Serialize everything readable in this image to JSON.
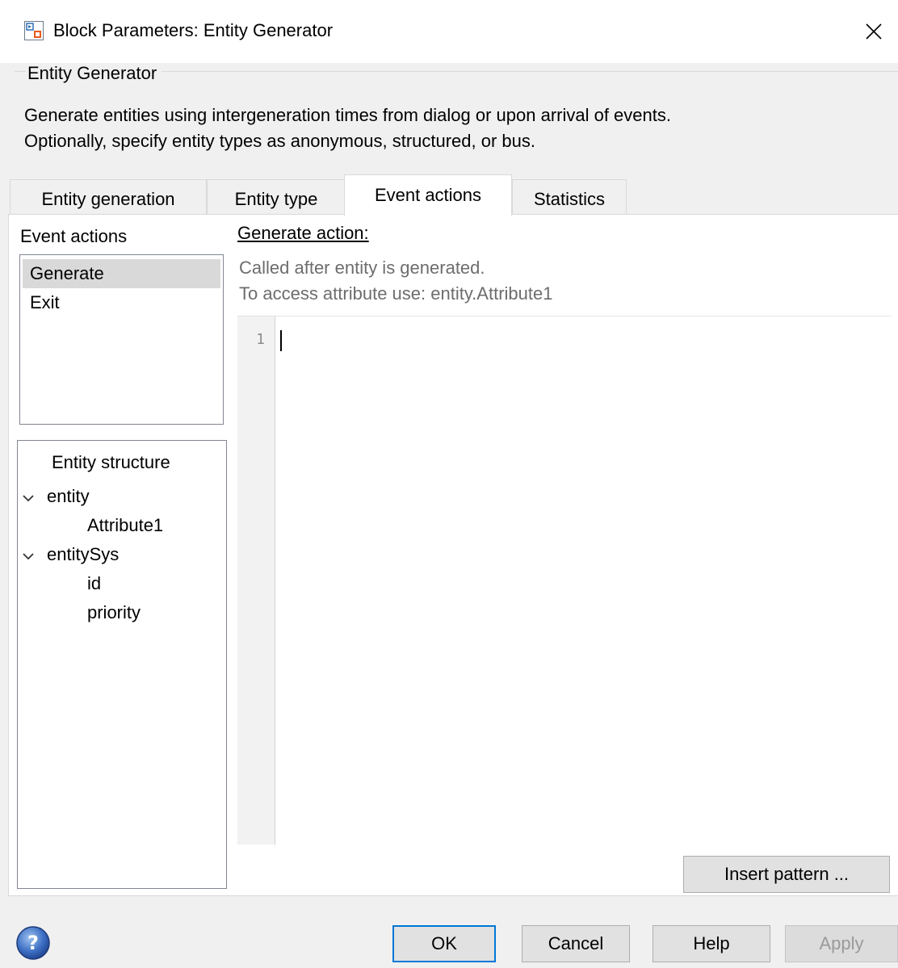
{
  "window": {
    "title": "Block Parameters: Entity Generator"
  },
  "group": {
    "title": "Entity Generator",
    "description_line1": "Generate entities using intergeneration times from dialog or upon arrival of events.",
    "description_line2": "Optionally, specify entity types as anonymous, structured, or bus."
  },
  "tabs": [
    {
      "label": "Entity generation"
    },
    {
      "label": "Entity type"
    },
    {
      "label": "Event actions"
    },
    {
      "label": "Statistics"
    }
  ],
  "active_tab": "Event actions",
  "event_actions": {
    "label": "Event actions",
    "items": [
      {
        "label": "Generate",
        "selected": true
      },
      {
        "label": "Exit",
        "selected": false
      }
    ]
  },
  "entity_structure": {
    "title": "Entity structure",
    "nodes": [
      {
        "label": "entity",
        "children": [
          "Attribute1"
        ]
      },
      {
        "label": "entitySys",
        "children": [
          "id",
          "priority"
        ]
      }
    ]
  },
  "generate_action": {
    "label": "Generate action:",
    "hint_line1": "Called after entity is generated.",
    "hint_line2": "To access attribute use: entity.Attribute1",
    "line_number": "1",
    "code": ""
  },
  "buttons": {
    "insert_pattern": "Insert pattern ...",
    "ok": "OK",
    "cancel": "Cancel",
    "help": "Help",
    "apply": "Apply"
  },
  "colors": {
    "accent": "#0078d7",
    "background": "#f0f0f0",
    "selection": "#d9d9d9"
  },
  "icons": {
    "app": "simulink-block-icon",
    "close": "close-icon",
    "help": "help-question-icon"
  }
}
